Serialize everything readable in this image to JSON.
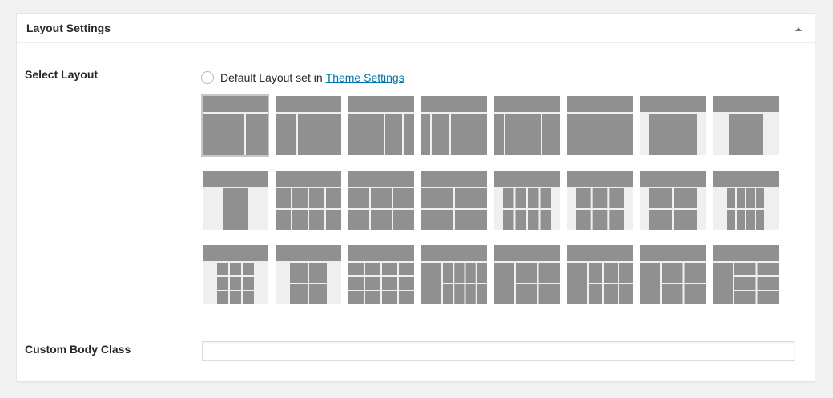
{
  "panel": {
    "title": "Layout Settings",
    "toggle_icon": "triangle-up-icon"
  },
  "select_layout": {
    "label": "Select Layout",
    "default_option_text": "Default Layout set in",
    "default_option_link": "Theme Settings",
    "selected_index": 0,
    "layouts": [
      "content-sidebar",
      "sidebar-content",
      "content-sidebar-sidebar",
      "sidebar-sidebar-content",
      "sidebar-content-sidebar",
      "full-width-content",
      "centered-content",
      "narrow-centered-content",
      "extra-narrow-centered-content",
      "four-columns-two-rows",
      "three-columns-two-rows",
      "two-columns-two-rows",
      "centered-four-columns",
      "centered-three-columns",
      "centered-two-columns",
      "narrow-centered-four-columns",
      "extra-narrow-three-columns",
      "extra-narrow-two-columns",
      "five-columns-three-rows",
      "sidebar-five-columns",
      "sidebar-four-columns",
      "sidebar-three-columns",
      "sidebar-two-columns",
      "sidebar-two-columns-wide"
    ]
  },
  "custom_body_class": {
    "label": "Custom Body Class",
    "value": ""
  },
  "colors": {
    "block": "#909090",
    "blank": "#efefef",
    "link": "#0073aa"
  }
}
